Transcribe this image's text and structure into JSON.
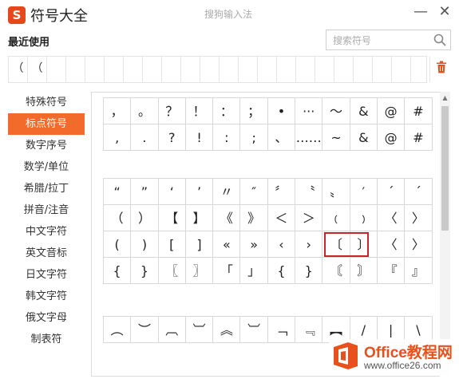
{
  "window": {
    "logo_letter": "S",
    "title": "符号大全",
    "ime_name": "搜狗输入法",
    "minimize": "—",
    "close": "✕"
  },
  "recent": {
    "label": "最近使用",
    "items": [
      "（",
      "（",
      "",
      "",
      "",
      "",
      "",
      "",
      "",
      "",
      "",
      "",
      "",
      "",
      "",
      "",
      "",
      "",
      "",
      "",
      "",
      ""
    ]
  },
  "search": {
    "placeholder": "搜索符号",
    "value": ""
  },
  "categories": [
    {
      "label": "特殊符号",
      "active": false
    },
    {
      "label": "标点符号",
      "active": true
    },
    {
      "label": "数字序号",
      "active": false
    },
    {
      "label": "数学/单位",
      "active": false
    },
    {
      "label": "希腊/拉丁",
      "active": false
    },
    {
      "label": "拼音/注音",
      "active": false
    },
    {
      "label": "中文字符",
      "active": false
    },
    {
      "label": "英文音标",
      "active": false
    },
    {
      "label": "日文字符",
      "active": false
    },
    {
      "label": "韩文字符",
      "active": false
    },
    {
      "label": "俄文字母",
      "active": false
    },
    {
      "label": "制表符",
      "active": false
    }
  ],
  "symbol_groups": [
    [
      [
        "，",
        "。",
        "？",
        "！",
        "：",
        "；",
        "•",
        "···",
        "～",
        "&",
        "@",
        "#"
      ],
      [
        ",",
        ".",
        "?",
        "!",
        ":",
        ";",
        "、",
        "……",
        "~",
        "&",
        "@",
        "#"
      ]
    ],
    [
      [
        "“",
        "”",
        "‘",
        "’",
        "〃",
        "″",
        "〞",
        "〝",
        "〟",
        "′",
        "´",
        "ˊ"
      ],
      [
        "（",
        "）",
        "【",
        "】",
        "《",
        "》",
        "＜",
        "＞",
        "﹙",
        "﹚",
        "〈",
        "〉"
      ],
      [
        "(",
        ")",
        "[",
        "]",
        "«",
        "»",
        "‹",
        "›",
        "〔",
        "〕",
        "〈",
        "〉"
      ],
      [
        "{",
        "}",
        "〖",
        "〗",
        "「",
        "」",
        "{",
        "}",
        "〘",
        "〙",
        "『",
        "』"
      ]
    ],
    [
      [
        "︵",
        "︶",
        "︹",
        "︺",
        "︽",
        "︺",
        "﹁",
        "﹃",
        "︻",
        "/",
        "|",
        "\\"
      ]
    ]
  ],
  "watermark": {
    "brand": "Office教程网",
    "url": "www.office26.com"
  },
  "colors": {
    "accent": "#f36b2b",
    "logo": "#e8461c",
    "highlight": "#c9232b"
  }
}
